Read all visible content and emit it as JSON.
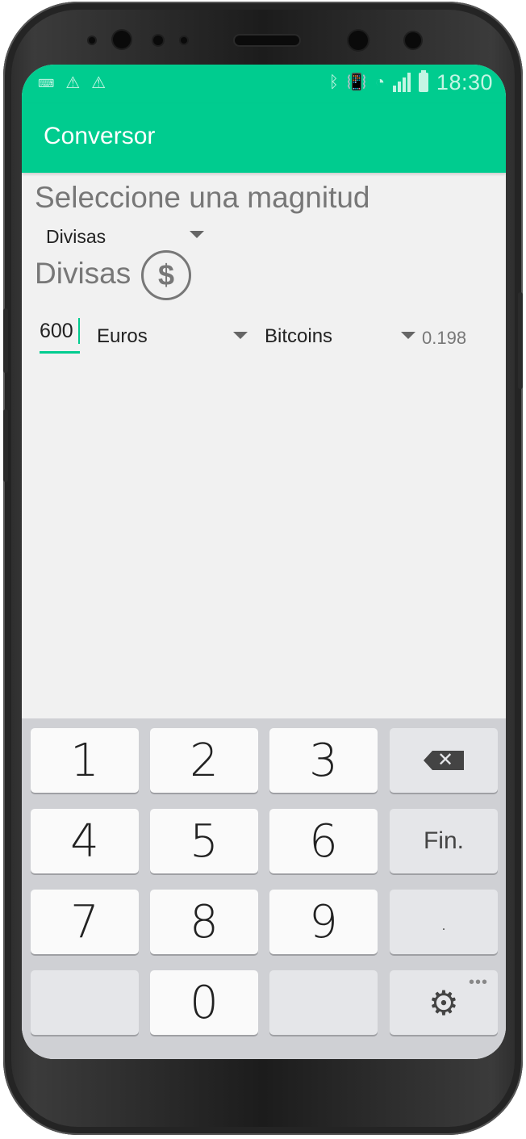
{
  "status_bar": {
    "time": "18:30",
    "left_icons": [
      "keyboard-icon",
      "warning-icon",
      "warning-icon"
    ],
    "right_icons": [
      "bluetooth-icon",
      "vibrate-icon",
      "wifi-icon",
      "signal-icon",
      "battery-icon"
    ]
  },
  "app_bar": {
    "title": "Conversor"
  },
  "main": {
    "heading": "Seleccione una magnitud",
    "magnitude_select": "Divisas",
    "section_title": "Divisas",
    "section_icon": "dollar-icon",
    "amount_value": "600",
    "from_unit": "Euros",
    "to_unit": "Bitcoins",
    "result": "0.198"
  },
  "keyboard": {
    "keys": [
      "1",
      "2",
      "3",
      "4",
      "5",
      "6",
      "7",
      "8",
      "9",
      "0"
    ],
    "done_label": "Fin.",
    "dot_label": ".",
    "more_label": "•••"
  },
  "colors": {
    "accent": "#00cc8f",
    "background": "#f1f1f1",
    "keyboard": "#cfd0d4"
  }
}
